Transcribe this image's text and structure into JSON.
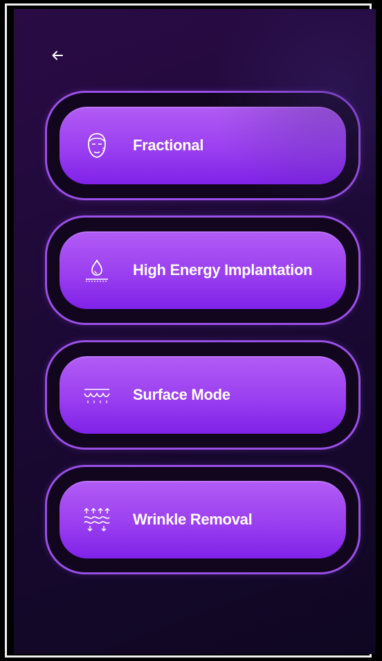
{
  "header": {
    "back_icon": "arrow-left-icon"
  },
  "modes": [
    {
      "label": "Fractional",
      "icon": "face-icon"
    },
    {
      "label": "High Energy Implantation",
      "icon": "droplet-skin-icon"
    },
    {
      "label": "Surface Mode",
      "icon": "wave-surface-icon"
    },
    {
      "label": "Wrinkle Removal",
      "icon": "wrinkle-lift-icon"
    }
  ],
  "colors": {
    "button_gradient_top": "#b25cf5",
    "button_gradient_bottom": "#7f22e8",
    "card_border": "#9a4fe6",
    "background": "#1c0935"
  }
}
